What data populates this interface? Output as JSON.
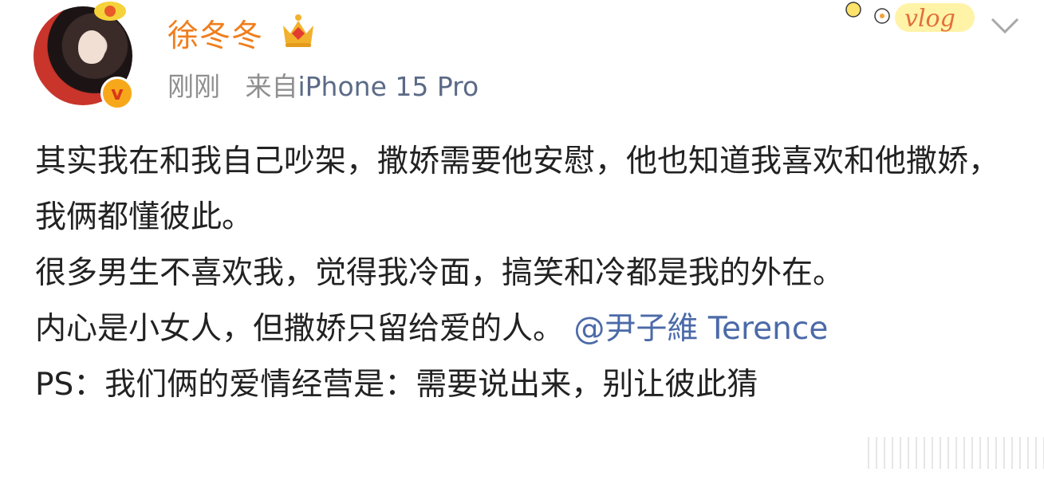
{
  "user": {
    "name": "徐冬冬",
    "time": "刚刚",
    "source_prefix": "来自",
    "source": "iPhone 15 Pro",
    "verified_mark": "v"
  },
  "sticker_text": "vlog",
  "post": {
    "paragraphs": [
      "其实我在和我自己吵架，撒娇需要他安慰，他也知道我喜欢和他撒娇，我俩都懂彼此。",
      "很多男生不喜欢我，觉得我冷面，搞笑和冷都是我的外在。",
      "内心是小女人，但撒娇只留给爱的人。",
      "PS：我们俩的爱情经营是：需要说出来，别让彼此猜"
    ],
    "mention": "@尹子維 Terence"
  },
  "colors": {
    "username": "#f07e1c",
    "meta": "#8f8f8f",
    "source": "#5b6a86",
    "text": "#222222",
    "mention": "#4b6aa8"
  },
  "icons": [
    "crown-icon",
    "verified-icon",
    "chevron-down-icon",
    "vlog-sticker-icon"
  ]
}
